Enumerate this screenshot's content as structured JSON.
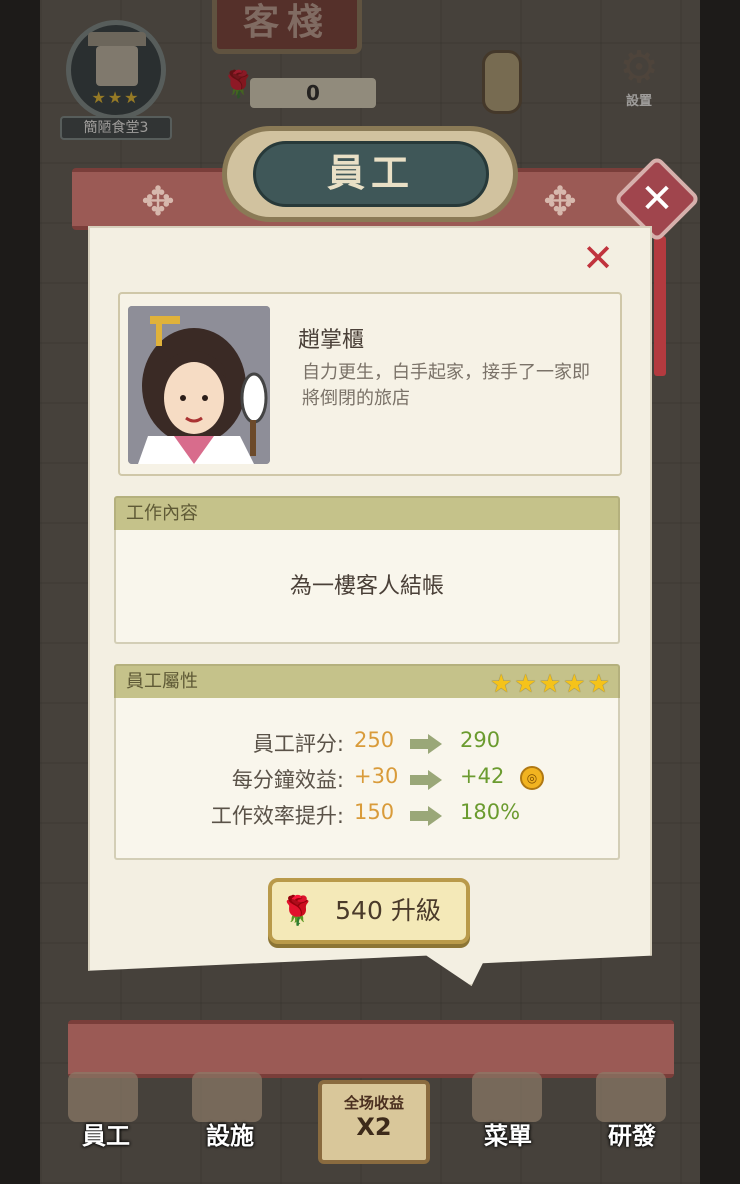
{
  "hud": {
    "restaurant_name": "簡陋食堂3",
    "restaurant_stars": 3,
    "currency_value": "0",
    "settings_label": "設置",
    "inn_sign": "客棧"
  },
  "dialog": {
    "title": "員工",
    "employee": {
      "name": "趙掌櫃",
      "description": "自力更生，白手起家，接手了一家即將倒閉的旅店"
    },
    "work_section": {
      "header": "工作內容",
      "content": "為一樓客人結帳"
    },
    "attributes_section": {
      "header": "員工屬性",
      "stars": 5,
      "rows": [
        {
          "label": "員工評分:",
          "old": "250",
          "new": "290"
        },
        {
          "label": "每分鐘效益:",
          "old": "+30",
          "new": "+42",
          "coin": true
        },
        {
          "label": "工作效率提升:",
          "old": "150",
          "new": "180%"
        }
      ]
    },
    "upgrade_button": "540 升級"
  },
  "tabbar": {
    "staff": "員工",
    "facilities": "設施",
    "boost_line1": "全场收益",
    "boost_line2": "X2",
    "menu": "菜單",
    "research": "研發"
  },
  "colors": {
    "accent_orange": "#d99b3a",
    "accent_green": "#6b9b2f",
    "star": "#f5c31a",
    "close_red": "#c0333d"
  }
}
